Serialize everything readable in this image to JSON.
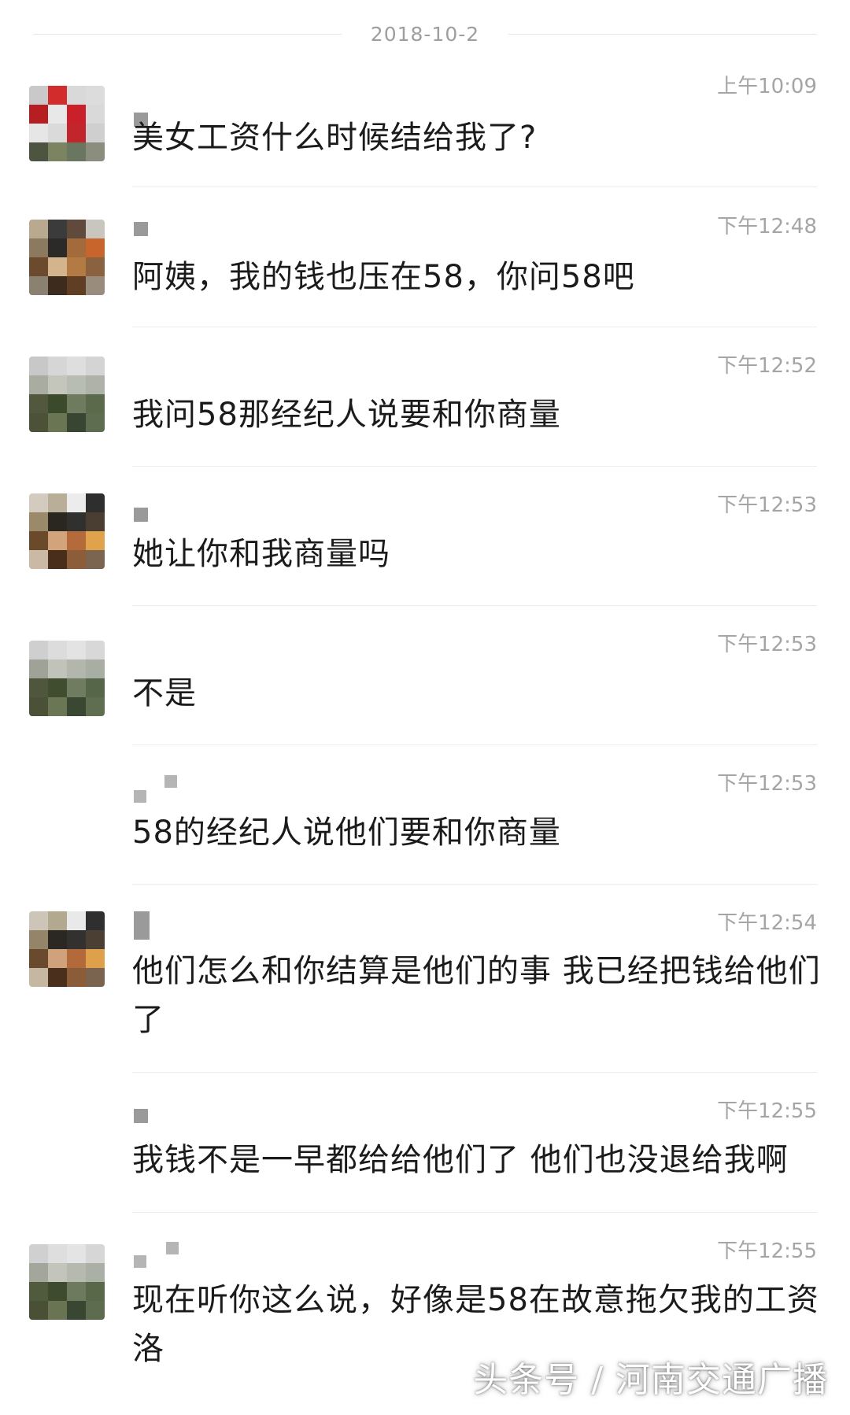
{
  "date_separator": "2018-10-2",
  "messages": [
    {
      "time": "上午10:09",
      "text": "美女工资什么时候结给我了?"
    },
    {
      "time": "下午12:48",
      "text": "阿姨，我的钱也压在58，你问58吧"
    },
    {
      "time": "下午12:52",
      "text": "我问58那经纪人说要和你商量"
    },
    {
      "time": "下午12:53",
      "text": "她让你和我商量吗"
    },
    {
      "time": "下午12:53",
      "text": "不是"
    },
    {
      "time": "下午12:53",
      "text": "58的经纪人说他们要和你商量"
    },
    {
      "time": "下午12:54",
      "text": "他们怎么和你结算是他们的事 我已经把钱给他们了"
    },
    {
      "time": "下午12:55",
      "text": "我钱不是一早都给给他们了 他们也没退给我啊"
    },
    {
      "time": "下午12:55",
      "text": "现在听你这么说，好像是58在故意拖欠我的工资洛"
    }
  ],
  "watermark": "头条号 / 河南交通广播",
  "colors": {
    "text": "#1b1b1b",
    "timestamp": "#a5a5a5",
    "divider": "#ececec",
    "background": "#ffffff"
  }
}
